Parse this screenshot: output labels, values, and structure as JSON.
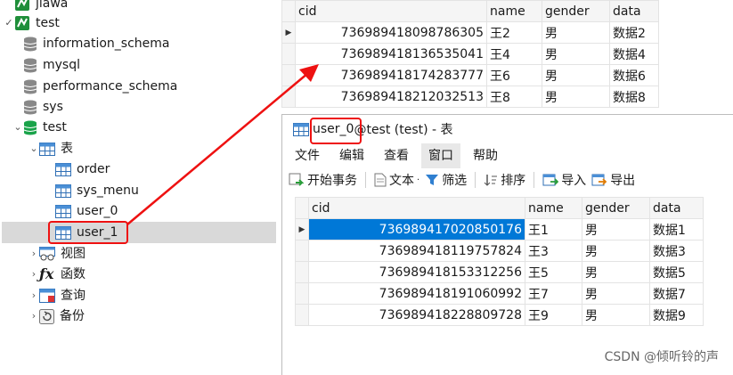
{
  "navigator": {
    "items": [
      {
        "label": "jiawa",
        "type": "connection",
        "indent": 0,
        "arrow": "",
        "partial": true
      },
      {
        "label": "test",
        "type": "connection",
        "indent": 0,
        "arrow": "✓"
      },
      {
        "label": "information_schema",
        "type": "database",
        "indent": 1,
        "arrow": ""
      },
      {
        "label": "mysql",
        "type": "database",
        "indent": 1,
        "arrow": ""
      },
      {
        "label": "performance_schema",
        "type": "database",
        "indent": 1,
        "arrow": ""
      },
      {
        "label": "sys",
        "type": "database",
        "indent": 1,
        "arrow": ""
      },
      {
        "label": "test",
        "type": "database-open",
        "indent": 1,
        "arrow": "⌄"
      },
      {
        "label": "表",
        "type": "tables",
        "indent": 2,
        "arrow": "⌄"
      },
      {
        "label": "order",
        "type": "table",
        "indent": 3,
        "arrow": ""
      },
      {
        "label": "sys_menu",
        "type": "table",
        "indent": 3,
        "arrow": ""
      },
      {
        "label": "user_0",
        "type": "table",
        "indent": 3,
        "arrow": ""
      },
      {
        "label": "user_1",
        "type": "table",
        "indent": 3,
        "arrow": "",
        "selected": true
      },
      {
        "label": "视图",
        "type": "views",
        "indent": 2,
        "arrow": "›"
      },
      {
        "label": "函数",
        "type": "functions",
        "indent": 2,
        "arrow": "›"
      },
      {
        "label": "查询",
        "type": "queries",
        "indent": 2,
        "arrow": "›"
      },
      {
        "label": "备份",
        "type": "backups",
        "indent": 2,
        "arrow": "›"
      }
    ]
  },
  "back_grid": {
    "columns": [
      "cid",
      "name",
      "gender",
      "data"
    ],
    "rows": [
      [
        "736989418098786305",
        "王2",
        "男",
        "数据2"
      ],
      [
        "736989418136535041",
        "王4",
        "男",
        "数据4"
      ],
      [
        "736989418174283777",
        "王6",
        "男",
        "数据6"
      ],
      [
        "736989418212032513",
        "王8",
        "男",
        "数据8"
      ]
    ]
  },
  "window": {
    "title_table": "user_0",
    "title_rest": " @test (test) - 表",
    "menu": [
      "文件",
      "编辑",
      "查看",
      "窗口",
      "帮助"
    ],
    "active_menu_index": 3,
    "toolbar": {
      "begin_transaction": "开始事务",
      "text": "文本",
      "filter": "筛选",
      "sort": "排序",
      "import": "导入",
      "export": "导出"
    },
    "grid": {
      "columns": [
        "cid",
        "name",
        "gender",
        "data"
      ],
      "rows": [
        [
          "736989417020850176",
          "王1",
          "男",
          "数据1"
        ],
        [
          "736989418119757824",
          "王3",
          "男",
          "数据3"
        ],
        [
          "736989418153312256",
          "王5",
          "男",
          "数据5"
        ],
        [
          "736989418191060992",
          "王7",
          "男",
          "数据7"
        ],
        [
          "736989418228809728",
          "王9",
          "男",
          "数据9"
        ]
      ],
      "selected_row": 0
    }
  },
  "colors": {
    "selection": "#0078d7",
    "annotation": "#e11111",
    "db_icon": "#888888",
    "db_open_icon": "#1aa34a"
  },
  "watermark": "CSDN @倾听铃的声"
}
